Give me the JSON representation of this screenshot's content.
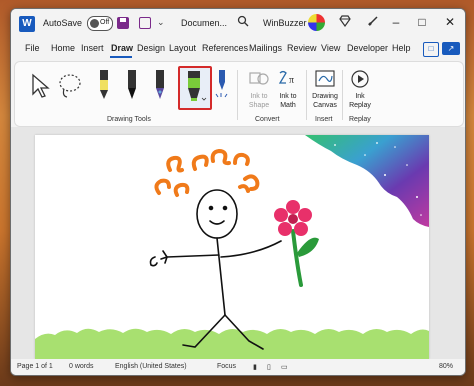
{
  "titlebar": {
    "app_letter": "W",
    "autosave_label": "AutoSave",
    "toggle_state": "Off",
    "more_glyph": "⌄",
    "document_title": "Documen...",
    "user_name": "WinBuzzer",
    "minimize": "–",
    "maximize": "□",
    "close": "✕"
  },
  "tabs": [
    "File",
    "Home",
    "Insert",
    "Draw",
    "Design",
    "Layout",
    "References",
    "Mailings",
    "Review",
    "View",
    "Developer",
    "Help"
  ],
  "active_tab": "Draw",
  "ribbon": {
    "groups": {
      "drawing_tools": "Drawing Tools",
      "convert": "Convert",
      "insert": "Insert",
      "replay": "Replay"
    },
    "buttons": {
      "ink_to_shape_1": "Ink to",
      "ink_to_shape_2": "Shape",
      "ink_to_math_1": "Ink to",
      "ink_to_math_2": "Math",
      "drawing_canvas_1": "Drawing",
      "drawing_canvas_2": "Canvas",
      "ink_replay_1": "Ink",
      "ink_replay_2": "Replay"
    },
    "pens": [
      {
        "name": "pencil",
        "color": "#f0e060"
      },
      {
        "name": "pen-black",
        "color": "#111111"
      },
      {
        "name": "pen-galaxy",
        "color": "#5a4aa0"
      },
      {
        "name": "highlighter-green",
        "color": "#7acb3a",
        "selected": true
      },
      {
        "name": "action-pen",
        "color": "#2b5ab0"
      }
    ]
  },
  "statusbar": {
    "page": "Page 1 of 1",
    "words": "0 words",
    "language": "English (United States)",
    "focus": "Focus",
    "zoom": "80%"
  },
  "colors": {
    "accent": "#185abd",
    "highlight_border": "#d42a2a",
    "hair": "#f07a1a",
    "flower": "#e8306a",
    "stem": "#2a9a3a",
    "grass": "#a8e070"
  },
  "icons": [
    "word-icon",
    "save-icon",
    "layout-icon",
    "search-icon",
    "diamond-icon",
    "pen-icon",
    "comment-icon",
    "share-icon",
    "lasso-select-icon",
    "select-pointer-icon",
    "ink-to-shape-icon",
    "ink-to-math-icon",
    "drawing-canvas-icon",
    "ink-replay-icon",
    "read-mode-icon",
    "print-layout-icon",
    "web-layout-icon"
  ]
}
